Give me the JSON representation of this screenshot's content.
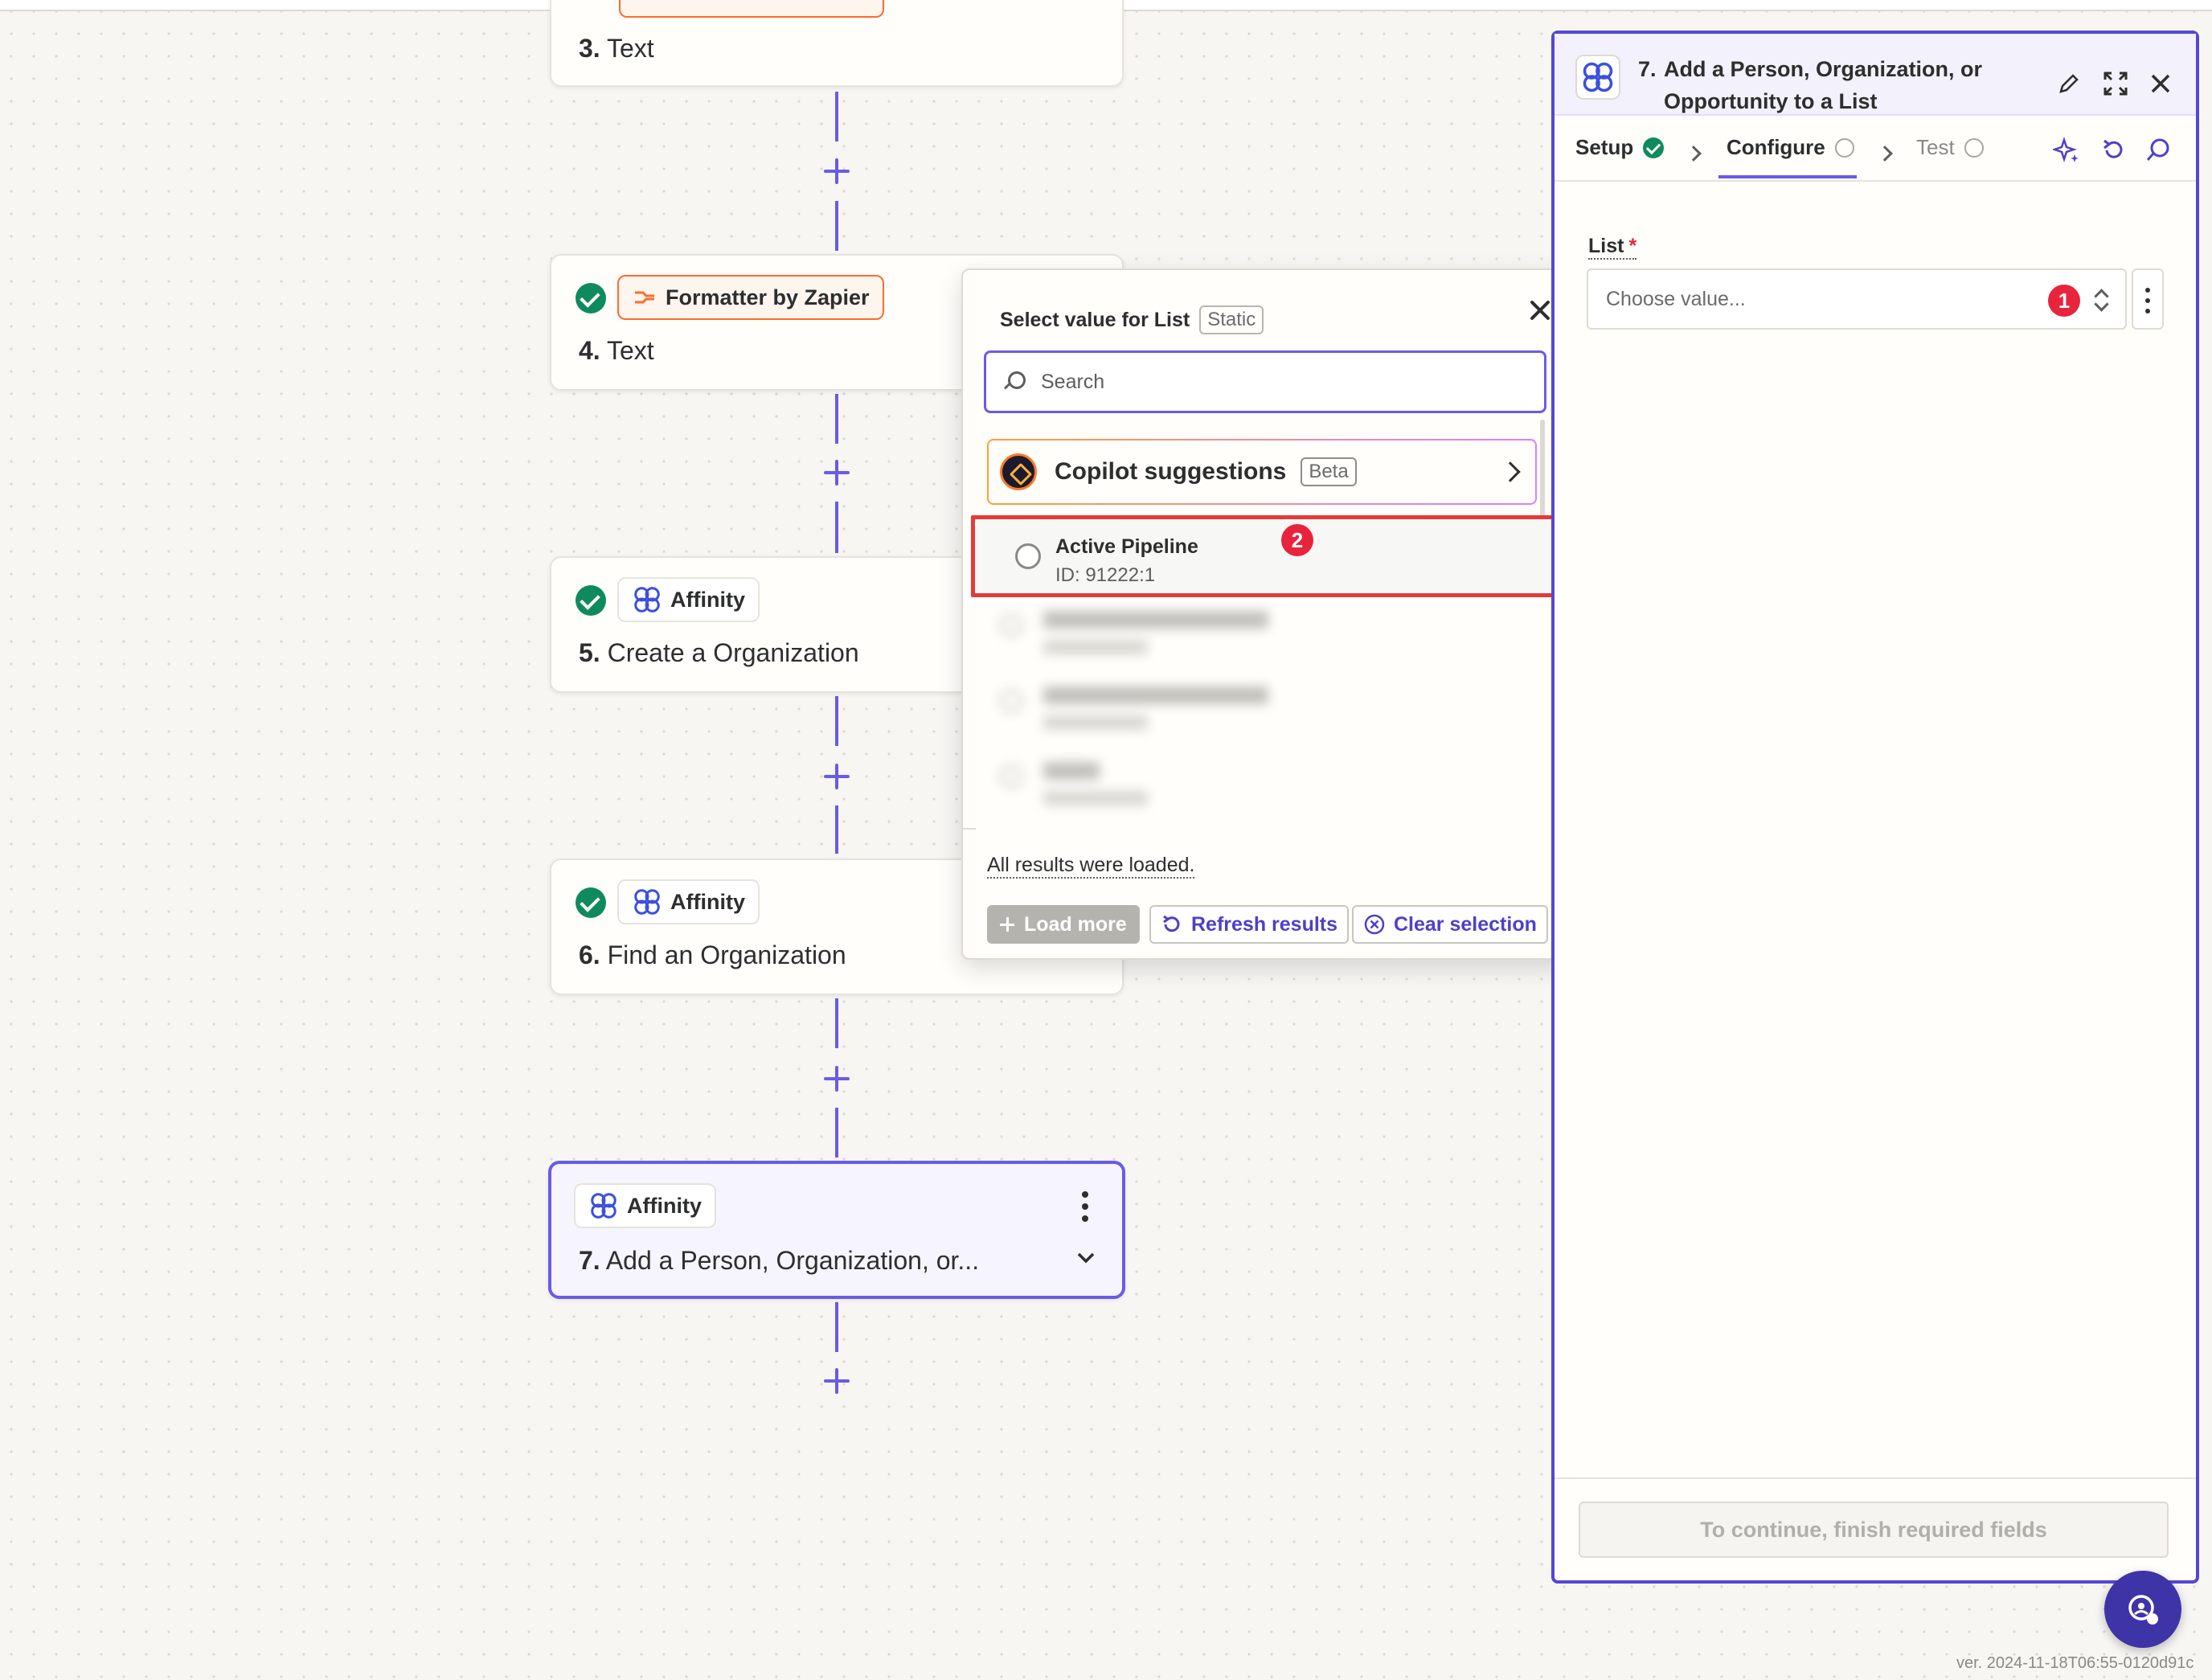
{
  "canvas": {
    "steps": [
      {
        "number": "3.",
        "title": "Text",
        "app": ""
      },
      {
        "number": "4.",
        "title": "Text",
        "app": "Formatter by Zapier"
      },
      {
        "number": "5.",
        "title": "Create a Organization",
        "app": "Affinity"
      },
      {
        "number": "6.",
        "title": "Find an Organization",
        "app": "Affinity"
      },
      {
        "number": "7.",
        "title": "Add a Person, Organization, or...",
        "app": "Affinity"
      }
    ]
  },
  "dropdown": {
    "title": "Select value for List",
    "static_tag": "Static",
    "search_placeholder": "Search",
    "copilot_label": "Copilot suggestions",
    "copilot_tag": "Beta",
    "option": {
      "label": "Active Pipeline",
      "sub": "ID: 91222:1"
    },
    "annotation_badge": "2",
    "status_text": "All results were loaded.",
    "buttons": {
      "load_more": "Load more",
      "refresh": "Refresh results",
      "clear": "Clear selection"
    }
  },
  "panel": {
    "step_number": "7.",
    "title": "Add a Person, Organization, or Opportunity to a List",
    "tabs": {
      "setup": "Setup",
      "configure": "Configure",
      "test": "Test"
    },
    "field_label": "List",
    "required_mark": "*",
    "field_placeholder": "Choose value...",
    "annotation_badge": "1",
    "continue_label": "To continue, finish required fields"
  },
  "footer": {
    "version": "ver. 2024-11-18T06:55-0120d91c"
  },
  "colors": {
    "accent": "#695be8",
    "success": "#0f8a5f",
    "error": "#e8243c",
    "formatter": "#ff6b2b"
  }
}
